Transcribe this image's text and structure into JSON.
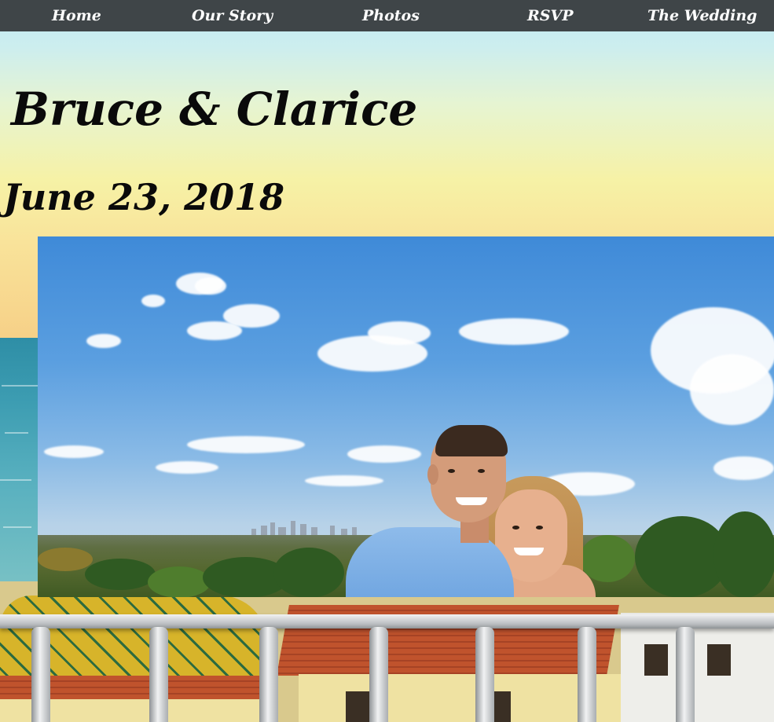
{
  "nav": {
    "items": [
      {
        "label": "Home"
      },
      {
        "label": "Our Story"
      },
      {
        "label": "Photos"
      },
      {
        "label": "RSVP"
      },
      {
        "label": "The Wedding"
      }
    ]
  },
  "hero": {
    "couple_names": "Bruce & Clarice",
    "wedding_date": "June 23, 2018"
  },
  "colors": {
    "nav_background": "#3f4548",
    "nav_text": "#ffffff",
    "title_text": "#0a0a0a"
  }
}
